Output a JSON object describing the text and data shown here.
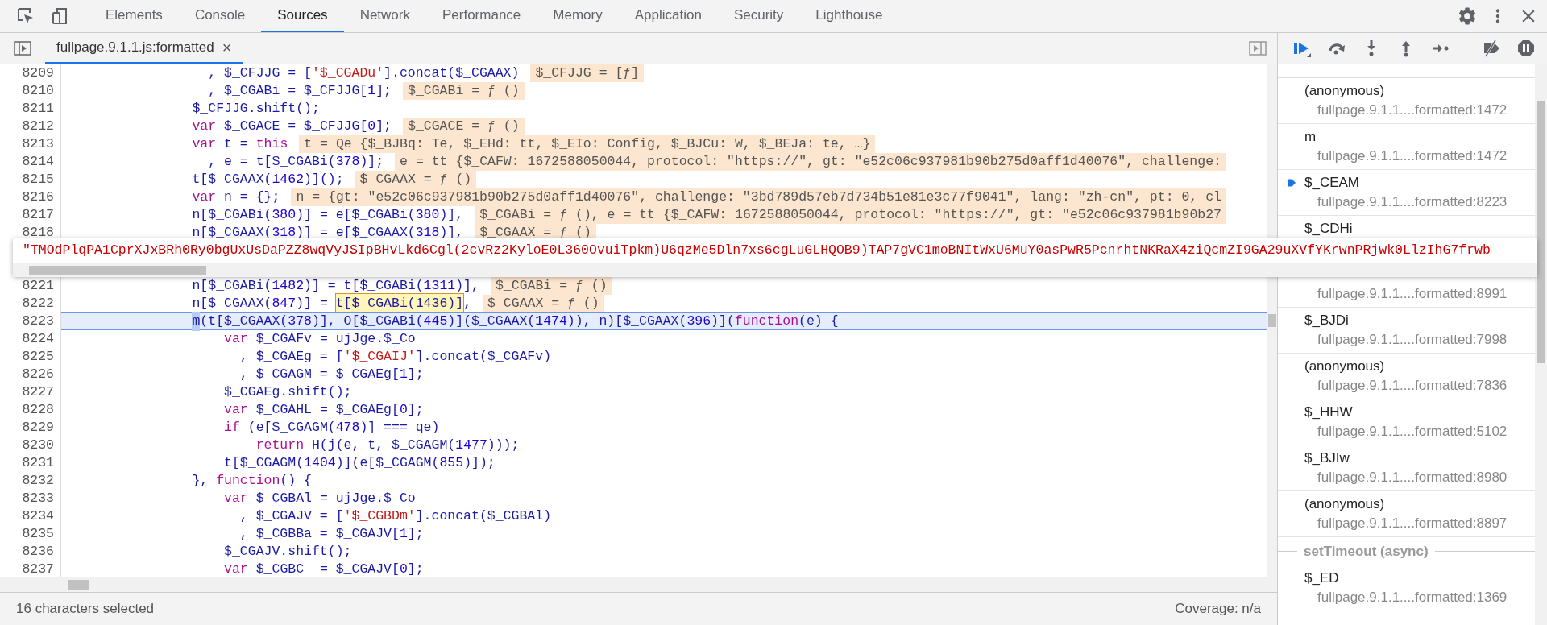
{
  "top_bar": {
    "tabs": [
      {
        "label": "Elements",
        "selected": false
      },
      {
        "label": "Console",
        "selected": false
      },
      {
        "label": "Sources",
        "selected": true
      },
      {
        "label": "Network",
        "selected": false
      },
      {
        "label": "Performance",
        "selected": false
      },
      {
        "label": "Memory",
        "selected": false
      },
      {
        "label": "Application",
        "selected": false
      },
      {
        "label": "Security",
        "selected": false
      },
      {
        "label": "Lighthouse",
        "selected": false
      }
    ]
  },
  "editor": {
    "file_tab": {
      "label": "fullpage.9.1.1.js:formatted",
      "close": "×"
    },
    "lines": [
      {
        "number": "8209",
        "current": false,
        "value": "$_CFJJG = [ƒ]",
        "tokens": [
          {
            "kind": "code",
            "text": "                  , $_CFJJG = ["
          },
          {
            "kind": "string",
            "text": "'$_CGADu'"
          },
          {
            "kind": "code",
            "text": "].concat($_CGAAX)"
          }
        ]
      },
      {
        "number": "8210",
        "current": false,
        "value": "$_CGABi = ƒ ()",
        "tokens": [
          {
            "kind": "code",
            "text": "                  , $_CGABi = $_CFJJG["
          },
          {
            "kind": "number",
            "text": "1"
          },
          {
            "kind": "code",
            "text": "];"
          }
        ]
      },
      {
        "number": "8211",
        "current": false,
        "tokens": [
          {
            "kind": "code",
            "text": "                $_CFJJG.shift();"
          }
        ]
      },
      {
        "number": "8212",
        "current": false,
        "value": "$_CGACE = ƒ ()",
        "tokens": [
          {
            "kind": "keyword",
            "text": "                var"
          },
          {
            "kind": "code",
            "text": " $_CGACE = $_CFJJG["
          },
          {
            "kind": "number",
            "text": "0"
          },
          {
            "kind": "code",
            "text": "];"
          }
        ]
      },
      {
        "number": "8213",
        "current": false,
        "value": "t = Qe {$_BJBq: Te, $_EHd: tt, $_EIo: Config, $_BJCu: W, $_BEJa: te, …}",
        "tokens": [
          {
            "kind": "keyword",
            "text": "                var"
          },
          {
            "kind": "code",
            "text": " t = "
          },
          {
            "kind": "keyword",
            "text": "this"
          }
        ]
      },
      {
        "number": "8214",
        "current": false,
        "value": "e = tt {$_CAFW: 1672588050044, protocol: \"https://\", gt: \"e52c06c937981b90b275d0aff1d40076\", challenge:",
        "tokens": [
          {
            "kind": "code",
            "text": "                  , e = t[$_CGABi("
          },
          {
            "kind": "number",
            "text": "378"
          },
          {
            "kind": "code",
            "text": ")];"
          }
        ]
      },
      {
        "number": "8215",
        "current": false,
        "value": "$_CGAAX = ƒ ()",
        "tokens": [
          {
            "kind": "code",
            "text": "                t[$_CGAAX("
          },
          {
            "kind": "number",
            "text": "1462"
          },
          {
            "kind": "code",
            "text": ")]();"
          }
        ]
      },
      {
        "number": "8216",
        "current": false,
        "value": "n = {gt: \"e52c06c937981b90b275d0aff1d40076\", challenge: \"3bd789d57eb7d734b51e81e3c77f9041\", lang: \"zh-cn\", pt: 0, cl",
        "tokens": [
          {
            "kind": "keyword",
            "text": "                var"
          },
          {
            "kind": "code",
            "text": " n = {};"
          }
        ]
      },
      {
        "number": "8217",
        "current": false,
        "value": "$_CGABi = ƒ (), e = tt {$_CAFW: 1672588050044, protocol: \"https://\", gt: \"e52c06c937981b90b27",
        "tokens": [
          {
            "kind": "code",
            "text": "                n[$_CGABi("
          },
          {
            "kind": "number",
            "text": "380"
          },
          {
            "kind": "code",
            "text": ")] = e[$_CGABi("
          },
          {
            "kind": "number",
            "text": "380"
          },
          {
            "kind": "code",
            "text": ")],"
          }
        ]
      },
      {
        "number": "8218",
        "current": false,
        "value": "$_CGAAX = ƒ ()",
        "tokens": [
          {
            "kind": "code",
            "text": "                n[$_CGAAX("
          },
          {
            "kind": "number",
            "text": "318"
          },
          {
            "kind": "code",
            "text": ")] = e[$_CGAAX("
          },
          {
            "kind": "number",
            "text": "318"
          },
          {
            "kind": "code",
            "text": ")],"
          }
        ]
      },
      {
        "number": "8221",
        "current": false,
        "value": "$_CGABi = ƒ ()",
        "tokens": [
          {
            "kind": "code",
            "text": "                n[$_CGABi("
          },
          {
            "kind": "number",
            "text": "1482"
          },
          {
            "kind": "code",
            "text": ")] = t[$_CGABi("
          },
          {
            "kind": "number",
            "text": "1311"
          },
          {
            "kind": "code",
            "text": ")],"
          }
        ]
      },
      {
        "number": "8222",
        "current": false,
        "value": "$_CGAAX = ƒ ()",
        "tokens": [
          {
            "kind": "code",
            "text": "                n[$_CGAAX("
          },
          {
            "kind": "number",
            "text": "847"
          },
          {
            "kind": "code",
            "text": ")] = "
          },
          {
            "kind": "hover",
            "text": "t[$_CGABi(1436)]"
          },
          {
            "kind": "code",
            "text": ","
          }
        ]
      },
      {
        "number": "8223",
        "current": true,
        "tokens": [
          {
            "kind": "selection",
            "text": "                m"
          },
          {
            "kind": "code",
            "text": "(t[$_CGAAX("
          },
          {
            "kind": "number",
            "text": "378"
          },
          {
            "kind": "code",
            "text": ")], O[$_CGABi("
          },
          {
            "kind": "number",
            "text": "445"
          },
          {
            "kind": "code",
            "text": ")]($_CGAAX("
          },
          {
            "kind": "number",
            "text": "1474"
          },
          {
            "kind": "code",
            "text": ")), n)[$_CGAAX("
          },
          {
            "kind": "number",
            "text": "396"
          },
          {
            "kind": "code",
            "text": ")]("
          },
          {
            "kind": "keyword",
            "text": "function"
          },
          {
            "kind": "code",
            "text": "(e) {"
          }
        ]
      },
      {
        "number": "8224",
        "current": false,
        "tokens": [
          {
            "kind": "keyword",
            "text": "                    var"
          },
          {
            "kind": "code",
            "text": " $_CGAFv = ujJge.$_Co"
          }
        ]
      },
      {
        "number": "8225",
        "current": false,
        "tokens": [
          {
            "kind": "code",
            "text": "                      , $_CGAEg = ["
          },
          {
            "kind": "string",
            "text": "'$_CGAIJ'"
          },
          {
            "kind": "code",
            "text": "].concat($_CGAFv)"
          }
        ]
      },
      {
        "number": "8226",
        "current": false,
        "tokens": [
          {
            "kind": "code",
            "text": "                      , $_CGAGM = $_CGAEg["
          },
          {
            "kind": "number",
            "text": "1"
          },
          {
            "kind": "code",
            "text": "];"
          }
        ]
      },
      {
        "number": "8227",
        "current": false,
        "tokens": [
          {
            "kind": "code",
            "text": "                    $_CGAEg.shift();"
          }
        ]
      },
      {
        "number": "8228",
        "current": false,
        "tokens": [
          {
            "kind": "keyword",
            "text": "                    var"
          },
          {
            "kind": "code",
            "text": " $_CGAHL = $_CGAEg["
          },
          {
            "kind": "number",
            "text": "0"
          },
          {
            "kind": "code",
            "text": "];"
          }
        ]
      },
      {
        "number": "8229",
        "current": false,
        "tokens": [
          {
            "kind": "keyword",
            "text": "                    if"
          },
          {
            "kind": "code",
            "text": " (e[$_CGAGM("
          },
          {
            "kind": "number",
            "text": "478"
          },
          {
            "kind": "code",
            "text": ")] === qe)"
          }
        ]
      },
      {
        "number": "8230",
        "current": false,
        "tokens": [
          {
            "kind": "keyword",
            "text": "                        return"
          },
          {
            "kind": "code",
            "text": " H(j(e, t, $_CGAGM("
          },
          {
            "kind": "number",
            "text": "1477"
          },
          {
            "kind": "code",
            "text": ")));"
          }
        ]
      },
      {
        "number": "8231",
        "current": false,
        "tokens": [
          {
            "kind": "code",
            "text": "                    t[$_CGAGM("
          },
          {
            "kind": "number",
            "text": "1404"
          },
          {
            "kind": "code",
            "text": ")](e[$_CGAGM("
          },
          {
            "kind": "number",
            "text": "855"
          },
          {
            "kind": "code",
            "text": ")]);"
          }
        ]
      },
      {
        "number": "8232",
        "current": false,
        "tokens": [
          {
            "kind": "code",
            "text": "                }, "
          },
          {
            "kind": "keyword",
            "text": "function"
          },
          {
            "kind": "code",
            "text": "() {"
          }
        ]
      },
      {
        "number": "8233",
        "current": false,
        "tokens": [
          {
            "kind": "keyword",
            "text": "                    var"
          },
          {
            "kind": "code",
            "text": " $_CGBAl = ujJge.$_Co"
          }
        ]
      },
      {
        "number": "8234",
        "current": false,
        "tokens": [
          {
            "kind": "code",
            "text": "                      , $_CGAJV = ["
          },
          {
            "kind": "string",
            "text": "'$_CGBDm'"
          },
          {
            "kind": "code",
            "text": "].concat($_CGBAl)"
          }
        ]
      },
      {
        "number": "8235",
        "current": false,
        "tokens": [
          {
            "kind": "code",
            "text": "                      , $_CGBBa = $_CGAJV["
          },
          {
            "kind": "number",
            "text": "1"
          },
          {
            "kind": "code",
            "text": "];"
          }
        ]
      },
      {
        "number": "8236",
        "current": false,
        "tokens": [
          {
            "kind": "code",
            "text": "                    $_CGAJV.shift();"
          }
        ]
      },
      {
        "number": "8237",
        "current": false,
        "tokens": [
          {
            "kind": "keyword",
            "text": "                    var"
          },
          {
            "kind": "code",
            "text": " $_CGBC  = $_CGAJV["
          },
          {
            "kind": "number",
            "text": "0"
          },
          {
            "kind": "code",
            "text": "];"
          }
        ]
      }
    ],
    "popover": {
      "value": "\"TMOdPlqPA1CprXJxBRh0Ry0bgUxUsDaPZZ8wqVyJSIpBHvLkd6Cgl(2cvRz2KyloE0L360OvuiTpkm)U6qzMe5Dln7xs6cgLuGLHQOB9)TAP7gVC1moBNItWxU6MuY0asPwR5PcnrhtNKRaX4ziQcmZI9GA29uXVfYKrwnPRjwk0LlzIhG7frwb"
    }
  },
  "status_bar": {
    "selection": "16 characters selected",
    "coverage": "Coverage: n/a"
  },
  "call_stack": {
    "frames": [
      {
        "kind": "frame",
        "current": false,
        "name": "(anonymous)",
        "location": "fullpage.9.1.1....formatted:1472"
      },
      {
        "kind": "frame",
        "current": false,
        "name": "m",
        "location": "fullpage.9.1.1....formatted:1472"
      },
      {
        "kind": "frame",
        "current": true,
        "name": "$_CEAM",
        "location": "fullpage.9.1.1....formatted:8223"
      },
      {
        "kind": "frame",
        "current": false,
        "name": "$_CDHi"
      },
      {
        "kind": "frame",
        "current": false,
        "location": "fullpage.9.1.1....formatted:8991"
      },
      {
        "kind": "frame",
        "current": false,
        "name": "$_BJDi",
        "location": "fullpage.9.1.1....formatted:7998"
      },
      {
        "kind": "frame",
        "current": false,
        "name": "(anonymous)",
        "location": "fullpage.9.1.1....formatted:7836"
      },
      {
        "kind": "frame",
        "current": false,
        "name": "$_HHW",
        "location": "fullpage.9.1.1....formatted:5102"
      },
      {
        "kind": "frame",
        "current": false,
        "name": "$_BJIw",
        "location": "fullpage.9.1.1....formatted:8980"
      },
      {
        "kind": "frame",
        "current": false,
        "name": "(anonymous)",
        "location": "fullpage.9.1.1....formatted:8897"
      },
      {
        "kind": "async",
        "label": "setTimeout (async)"
      },
      {
        "kind": "frame",
        "current": false,
        "name": "$_ED",
        "location": "fullpage.9.1.1....formatted:1369"
      }
    ]
  }
}
